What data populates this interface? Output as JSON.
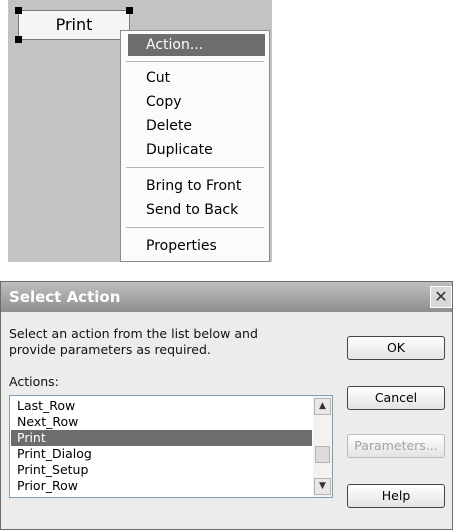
{
  "design_surface": {
    "button_label": "Print"
  },
  "context_menu": {
    "items": [
      {
        "label": "Action..."
      },
      {
        "label": "Cut"
      },
      {
        "label": "Copy"
      },
      {
        "label": "Delete"
      },
      {
        "label": "Duplicate"
      },
      {
        "label": "Bring to Front"
      },
      {
        "label": "Send to Back"
      },
      {
        "label": "Properties"
      }
    ],
    "highlighted_item": "Action..."
  },
  "dialog": {
    "title": "Select Action",
    "instructions": [
      "Select an action from the list below and",
      "provide parameters as required."
    ],
    "actions_label": "Actions:",
    "actions": [
      "Last_Row",
      "Next_Row",
      "Print",
      "Print_Dialog",
      "Print_Setup",
      "Prior_Row"
    ],
    "selected_action": "Print",
    "buttons": {
      "ok": "OK",
      "cancel": "Cancel",
      "parameters": "Parameters...",
      "help": "Help"
    },
    "parameters_enabled": false
  },
  "colors": {
    "highlight": "#6d6d6d",
    "canvas": "#c3c3c3",
    "dialog_bg": "#ececea"
  },
  "icons": [
    "close-icon",
    "scroll-up-arrow-icon",
    "scroll-down-arrow-icon"
  ]
}
